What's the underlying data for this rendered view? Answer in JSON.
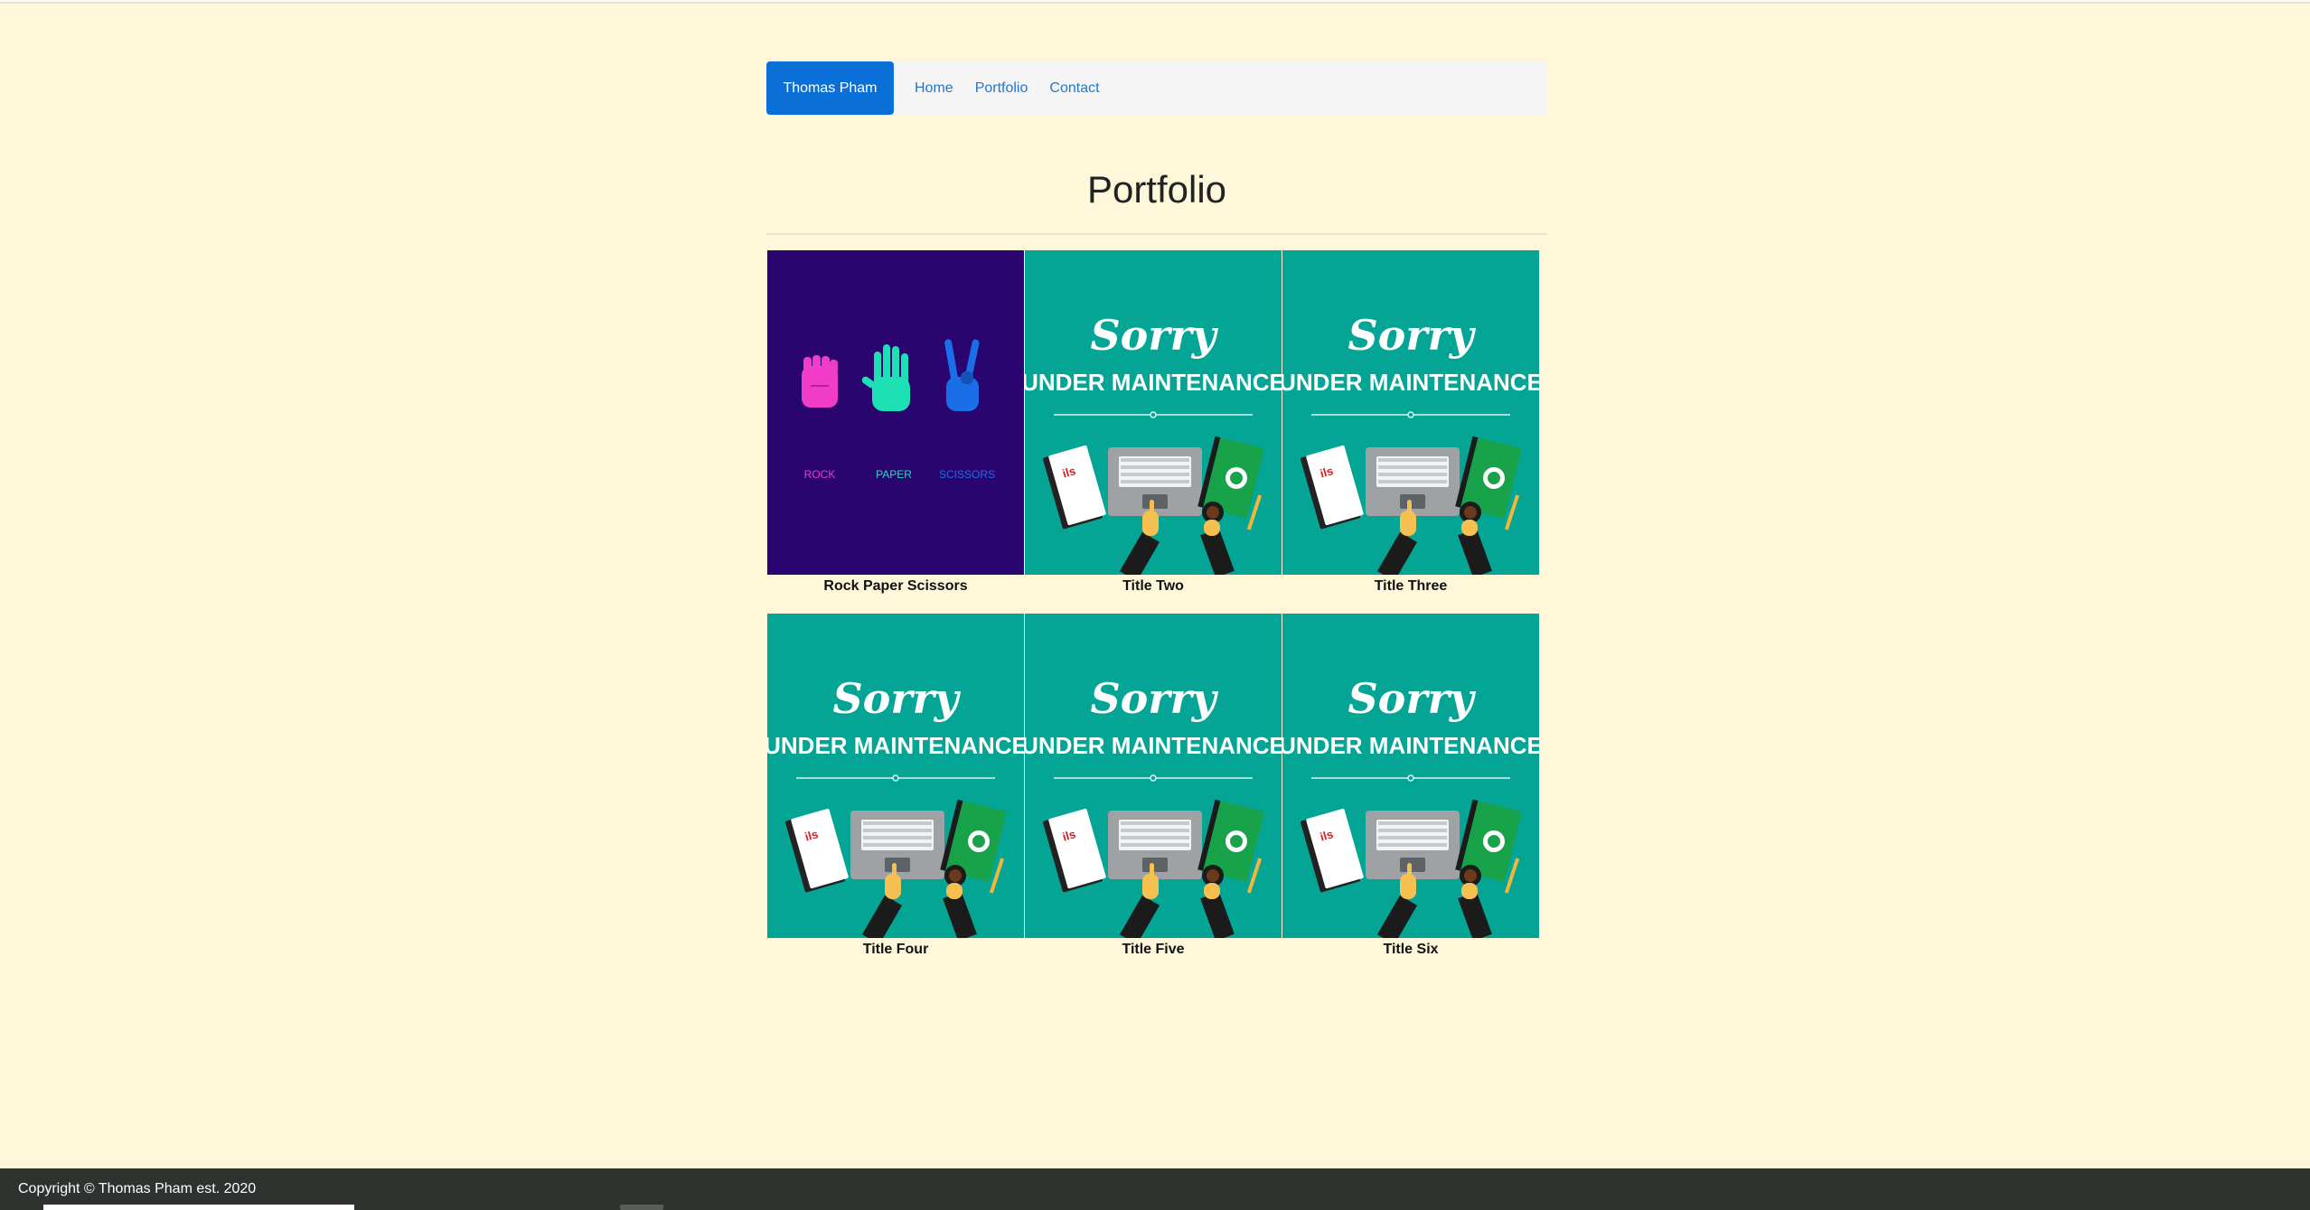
{
  "nav": {
    "brand": "Thomas Pham",
    "links": [
      "Home",
      "Portfolio",
      "Contact"
    ],
    "brand_color": "#0b6fd8",
    "link_color": "#2276d0"
  },
  "page": {
    "title": "Portfolio"
  },
  "portfolio": [
    {
      "caption": "Rock Paper Scissors",
      "image": "rock-paper-scissors"
    },
    {
      "caption": "Title Two",
      "image": "under-maintenance"
    },
    {
      "caption": "Title Three",
      "image": "under-maintenance"
    },
    {
      "caption": "Title Four",
      "image": "under-maintenance"
    },
    {
      "caption": "Title Five",
      "image": "under-maintenance"
    },
    {
      "caption": "Title Six",
      "image": "under-maintenance"
    }
  ],
  "rps_image": {
    "labels": [
      "ROCK",
      "PAPER",
      "SCISSORS"
    ],
    "background": "#2a0570"
  },
  "maintenance_image": {
    "line1": "Sorry",
    "line2": "UNDER MAINTENANCE",
    "book_text": "ils",
    "background": "#05a596"
  },
  "footer": {
    "copyright": "Copyright © Thomas Pham est. 2020"
  }
}
